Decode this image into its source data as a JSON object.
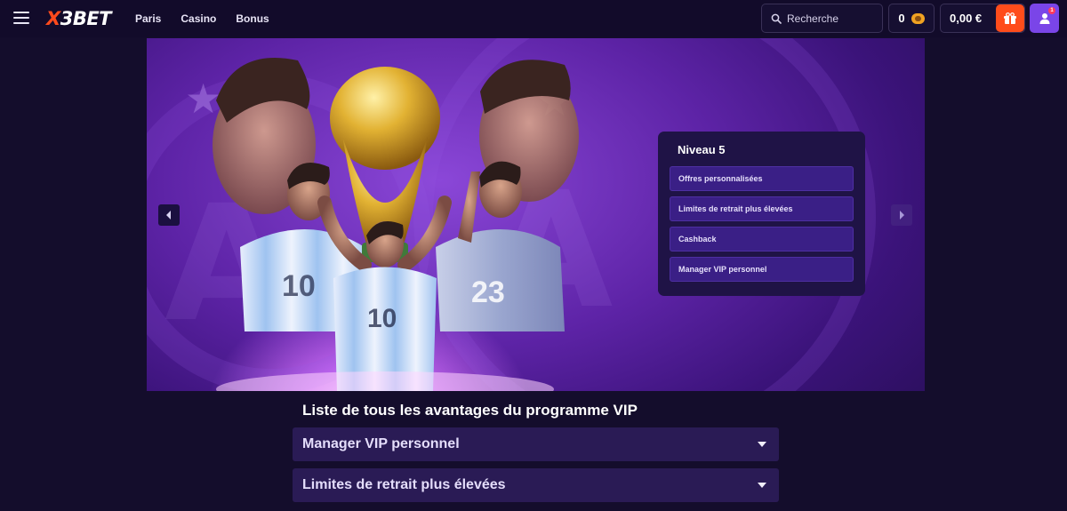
{
  "brand": {
    "logo_prefix": "X",
    "logo_rest": "3BET",
    "accent": "#ff4a1c",
    "profile_accent": "#7a45e8"
  },
  "nav": {
    "items": [
      "Paris",
      "Casino",
      "Bonus"
    ]
  },
  "header": {
    "search_label": "Recherche",
    "coins": "0",
    "balance": "0,00 €",
    "notification_count": "1"
  },
  "banner": {
    "jersey_numbers": [
      "10",
      "10",
      "23"
    ],
    "level_panel": {
      "title": "Niveau 5",
      "items": [
        "Offres personnalisées",
        "Limites de retrait plus élevées",
        "Cashback",
        "Manager VIP personnel"
      ]
    }
  },
  "vip_section": {
    "title": "Liste de tous les avantages du programme VIP",
    "accordions": [
      "Manager VIP personnel",
      "Limites de retrait plus élevées"
    ]
  },
  "icons": {
    "menu": "hamburger-icon",
    "search": "search-icon",
    "coin": "coin-icon",
    "deposit": "gift-icon",
    "profile": "user-icon",
    "prev": "chevron-left-icon",
    "next": "chevron-right-icon",
    "expand": "caret-down-icon"
  }
}
